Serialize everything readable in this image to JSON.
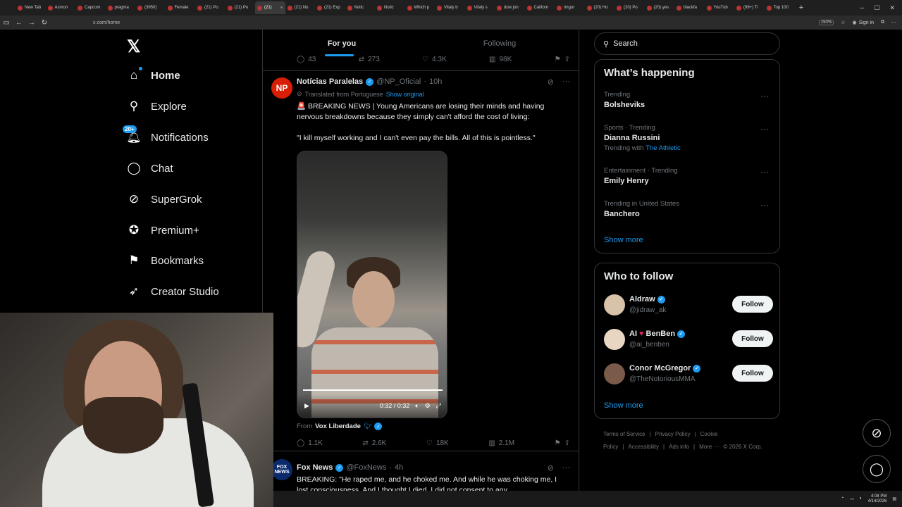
{
  "browser": {
    "tabs": [
      {
        "label": "New Tab",
        "active": false
      },
      {
        "label": "Asmon",
        "active": false
      },
      {
        "label": "Capcom",
        "active": false
      },
      {
        "label": "pragma",
        "active": false
      },
      {
        "label": "(3950)",
        "active": false
      },
      {
        "label": "Female",
        "active": false
      },
      {
        "label": "(21) Po",
        "active": false
      },
      {
        "label": "(21) Po",
        "active": false
      },
      {
        "label": "(21)",
        "active": true
      },
      {
        "label": "(21) No",
        "active": false
      },
      {
        "label": "(21) Exp",
        "active": false
      },
      {
        "label": "Notic",
        "active": false
      },
      {
        "label": "Notic",
        "active": false
      },
      {
        "label": "Which p",
        "active": false
      },
      {
        "label": "Vitaly b",
        "active": false
      },
      {
        "label": "Vitaly s",
        "active": false
      },
      {
        "label": "dow jon",
        "active": false
      },
      {
        "label": "Californ",
        "active": false
      },
      {
        "label": "Imgur",
        "active": false
      },
      {
        "label": "(20) Ho",
        "active": false
      },
      {
        "label": "(20) Po",
        "active": false
      },
      {
        "label": "(20) yes",
        "active": false
      },
      {
        "label": "blackfa",
        "active": false
      },
      {
        "label": "YouTub",
        "active": false
      },
      {
        "label": "(99+) Ti",
        "active": false
      },
      {
        "label": "Top 100",
        "active": false
      }
    ],
    "new_tab": "+",
    "url": "x.com/home",
    "zoom": "150%",
    "sign_in": "Sign in"
  },
  "leftnav": {
    "logo": "𝕏",
    "items": [
      {
        "label": "Home",
        "icon": "home-icon"
      },
      {
        "label": "Explore",
        "icon": "search-icon"
      },
      {
        "label": "Notifications",
        "icon": "bell-icon",
        "badge": "20+"
      },
      {
        "label": "Chat",
        "icon": "chat-icon"
      },
      {
        "label": "SuperGrok",
        "icon": "grok-icon"
      },
      {
        "label": "Premium+",
        "icon": "premium-icon"
      },
      {
        "label": "Bookmarks",
        "icon": "bookmark-icon"
      },
      {
        "label": "Creator Studio",
        "icon": "rocket-icon"
      }
    ]
  },
  "feed": {
    "tabs": [
      "For you",
      "Following"
    ],
    "prev_actions": {
      "replies": "43",
      "reposts": "273",
      "likes": "4.3K",
      "views": "98K"
    },
    "tweet1": {
      "avatar_text": "NP",
      "name": "Notícias Paralelas",
      "handle": "@NP_Oficial",
      "time": "10h",
      "translated": "Translated from Portuguese",
      "show_original": "Show original",
      "text1": "🚨 BREAKING NEWS | Young Americans are losing their minds and having nervous breakdowns because they simply can't afford the cost of living:",
      "text2": "\"I kill myself working and I can't even pay the bills. All of this is pointless.\"",
      "video_time": "0:32 / 0:32",
      "from_label": "From",
      "from_name": "Vox Liberdade",
      "replies": "1.1K",
      "reposts": "2.6K",
      "likes": "18K",
      "views": "2.1M"
    },
    "tweet2": {
      "avatar_text": "FOX NEWS",
      "name": "Fox News",
      "handle": "@FoxNews",
      "time": "4h",
      "text": "BREAKING: \"He raped me, and he choked me. And while he was choking me, I lost consciousness. And I thought I died. I did not consent to any"
    }
  },
  "right": {
    "search_placeholder": "Search",
    "happening_title": "What’s happening",
    "trends": [
      {
        "meta": "Trending",
        "name": "Bolsheviks",
        "with": ""
      },
      {
        "meta": "Sports · Trending",
        "name": "Dianna Russini",
        "with_label": "Trending with",
        "with": "The Athletic"
      },
      {
        "meta": "Entertainment · Trending",
        "name": "Emily Henry",
        "with": ""
      },
      {
        "meta": "Trending in United States",
        "name": "Banchero",
        "with": ""
      }
    ],
    "show_more": "Show more",
    "who_title": "Who to follow",
    "who": [
      {
        "name": "Aldraw",
        "handle": "@jidraw_ak",
        "button": "Follow"
      },
      {
        "name_prefix": "AI",
        "name_suffix": "BenBen",
        "handle": "@ai_benben",
        "button": "Follow"
      },
      {
        "name": "Conor McGregor",
        "handle": "@TheNotoriousMMA",
        "button": "Follow"
      }
    ],
    "who_show_more": "Show more",
    "footer": [
      "Terms of Service",
      "|",
      "Privacy Policy",
      "|",
      "Cookie Policy",
      "|",
      "Accessibility",
      "|",
      "Ads info",
      "|",
      "More ···",
      "© 2026 X Corp."
    ]
  },
  "taskbar": {
    "time": "4:08 PM",
    "date": "4/14/2026"
  },
  "colors": {
    "accent": "#1d9bf0",
    "bg": "#000000",
    "border": "#2f3336",
    "muted": "#71767b"
  }
}
